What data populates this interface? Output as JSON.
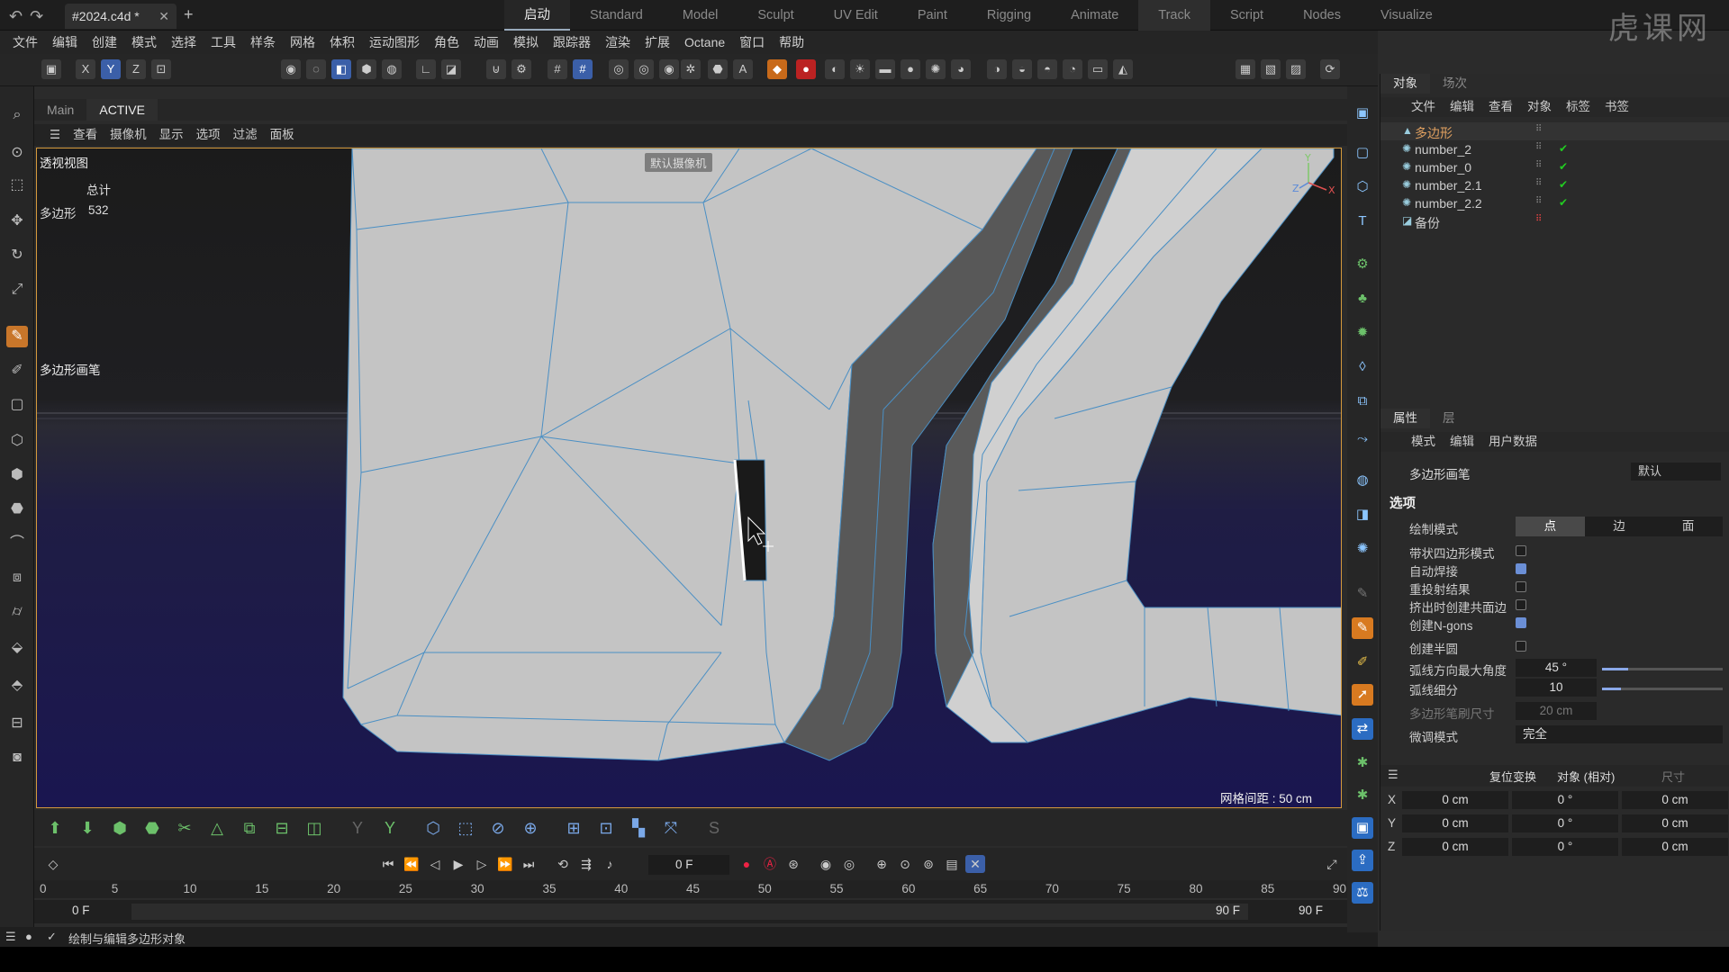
{
  "app": {
    "doc_tab": "#2024.c4d *",
    "watermark": "虎课网"
  },
  "layouts": [
    "启动",
    "Standard",
    "Model",
    "Sculpt",
    "UV Edit",
    "Paint",
    "Rigging",
    "Animate",
    "Track",
    "Script",
    "Nodes",
    "Visualize"
  ],
  "menu": [
    "文件",
    "编辑",
    "创建",
    "模式",
    "选择",
    "工具",
    "样条",
    "网格",
    "体积",
    "运动图形",
    "角色",
    "动画",
    "模拟",
    "跟踪器",
    "渲染",
    "扩展",
    "Octane",
    "窗口",
    "帮助"
  ],
  "toolbar": {
    "axis_x": "X",
    "axis_y": "Y",
    "axis_z": "Z"
  },
  "viewport": {
    "tabs": [
      "Main",
      "ACTIVE"
    ],
    "menu": [
      "查看",
      "摄像机",
      "显示",
      "选项",
      "过滤",
      "面板"
    ],
    "label": "透视视图",
    "stats_header": "总计",
    "stats_label": "多边形",
    "stats_value": "532",
    "tool_label": "多边形画笔",
    "camera_label": "默认摄像机",
    "grid_label": "网格间距 : 50 cm",
    "axis_y": "Y",
    "axis_z": "Z",
    "axis_x": "X"
  },
  "timeline": {
    "current_frame": "0 F",
    "ticks": [
      "0",
      "5",
      "10",
      "15",
      "20",
      "25",
      "30",
      "35",
      "40",
      "45",
      "50",
      "55",
      "60",
      "65",
      "70",
      "75",
      "80",
      "85",
      "90"
    ],
    "start_left": "0 F",
    "start_right": "0 F",
    "end_inner": "90 F",
    "end_outer": "90 F"
  },
  "status": {
    "text": "绘制与编辑多边形对象"
  },
  "objects_panel": {
    "tabs": [
      "对象",
      "场次"
    ],
    "menu": [
      "文件",
      "编辑",
      "查看",
      "对象",
      "标签",
      "书签"
    ],
    "items": [
      {
        "name": "多边形",
        "selected": true
      },
      {
        "name": "number_2"
      },
      {
        "name": "number_0"
      },
      {
        "name": "number_2.1"
      },
      {
        "name": "number_2.2"
      },
      {
        "name": "备份"
      }
    ]
  },
  "attributes_panel": {
    "tabs": [
      "属性",
      "层"
    ],
    "menu": [
      "模式",
      "编辑",
      "用户数据"
    ],
    "tool_name": "多边形画笔",
    "preset": "默认",
    "section": "选项",
    "draw_mode_label": "绘制模式",
    "draw_modes": [
      "点",
      "边",
      "面"
    ],
    "options": [
      {
        "label": "带状四边形模式",
        "checked": false
      },
      {
        "label": "自动焊接",
        "checked": true
      },
      {
        "label": "重投射结果",
        "checked": false
      },
      {
        "label": "挤出时创建共面边",
        "checked": false
      },
      {
        "label": "创建N-gons",
        "checked": true
      },
      {
        "label": "创建半圆",
        "checked": false
      }
    ],
    "arc_angle_label": "弧线方向最大角度",
    "arc_angle_value": "45 °",
    "arc_angle_fraction": 0.22,
    "arc_subdiv_label": "弧线细分",
    "arc_subdiv_value": "10",
    "arc_subdiv_fraction": 0.16,
    "brush_size_label": "多边形笔刷尺寸",
    "brush_size_value": "20 cm",
    "tweak_label": "微调模式",
    "tweak_value": "完全"
  },
  "coordinates": {
    "reset_label": "复位变换",
    "mode_label": "对象 (相对)",
    "size_label": "尺寸",
    "rows": [
      {
        "axis": "X",
        "pos": "0 cm",
        "rot": "0 °",
        "size": "0 cm"
      },
      {
        "axis": "Y",
        "pos": "0 cm",
        "rot": "0 °",
        "size": "0 cm"
      },
      {
        "axis": "Z",
        "pos": "0 cm",
        "rot": "0 °",
        "size": "0 cm"
      }
    ]
  },
  "colors": {
    "accent": "#d87a20",
    "selection_blue": "#3b5fa8",
    "mesh_face": "#c4c4c4",
    "mesh_wire": "#4a8fc4",
    "background_top": "#1a1a1a",
    "background_bottom": "#1c1a4a"
  }
}
